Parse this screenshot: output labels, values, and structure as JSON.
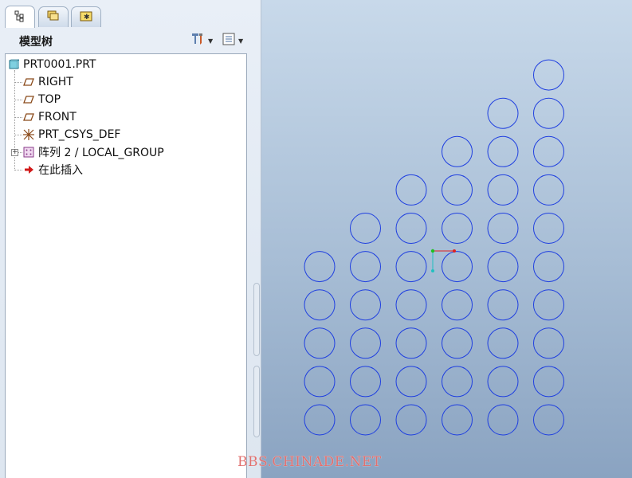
{
  "panel": {
    "title": "模型树",
    "tabs": [
      {
        "icon": "model-tree-icon"
      },
      {
        "icon": "folder-browser-icon"
      },
      {
        "icon": "favorites-icon"
      }
    ],
    "tools": [
      {
        "icon": "tree-settings-icon"
      },
      {
        "icon": "tree-columns-icon"
      }
    ]
  },
  "tree": {
    "root": "PRT0001.PRT",
    "items": [
      {
        "label": "RIGHT",
        "icon": "datum-plane-icon"
      },
      {
        "label": "TOP",
        "icon": "datum-plane-icon"
      },
      {
        "label": "FRONT",
        "icon": "datum-plane-icon"
      },
      {
        "label": "PRT_CSYS_DEF",
        "icon": "coordinate-system-icon"
      },
      {
        "label": "阵列 2 / LOCAL_GROUP",
        "icon": "pattern-icon"
      },
      {
        "label": "在此插入",
        "icon": "insert-here-arrow-icon"
      }
    ]
  },
  "graphics": {
    "background_top": "#c8d9ea",
    "background_bottom": "#8aa3c1",
    "circle_color": "#1f3fe0",
    "columns": [
      {
        "column": 1,
        "circles": 5
      },
      {
        "column": 2,
        "circles": 6
      },
      {
        "column": 3,
        "circles": 7
      },
      {
        "column": 4,
        "circles": 8
      },
      {
        "column": 5,
        "circles": 9
      },
      {
        "column": 6,
        "circles": 10
      }
    ]
  },
  "watermark": "BBS.CHINADE.NET"
}
